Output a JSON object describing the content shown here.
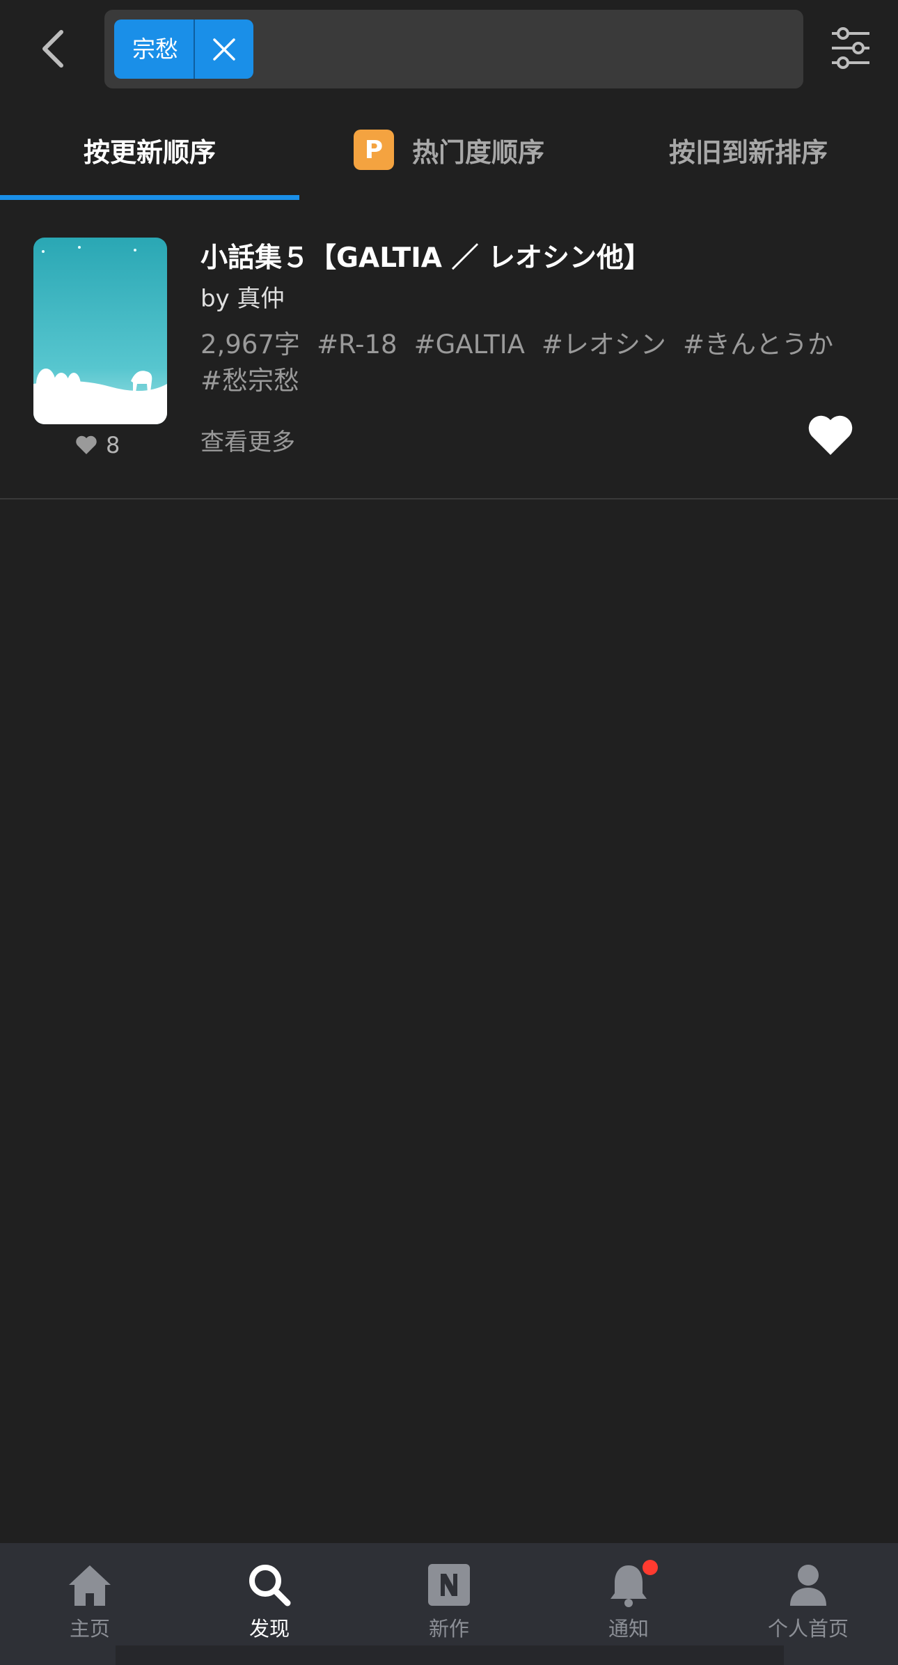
{
  "search": {
    "chip_label": "宗愁"
  },
  "tabs": [
    {
      "label": "按更新顺序",
      "active": true
    },
    {
      "label": "热门度顺序",
      "badge": "P",
      "active": false
    },
    {
      "label": "按旧到新排序",
      "active": false
    }
  ],
  "item": {
    "title": "小話集５【GALTIA ／ レオシン他】",
    "author": "by 真仲",
    "char_count": "2,967字",
    "tags": [
      "#R-18",
      "#GALTIA",
      "#レオシン",
      "#きんとうか",
      "#愁宗愁"
    ],
    "likes": "8",
    "more_label": "查看更多"
  },
  "bottom_nav": [
    {
      "label": "主页",
      "icon": "home-icon",
      "active": false
    },
    {
      "label": "发现",
      "icon": "search-icon",
      "active": true
    },
    {
      "label": "新作",
      "icon": "new-icon",
      "active": false
    },
    {
      "label": "通知",
      "icon": "bell-icon",
      "active": false,
      "has_badge": true
    },
    {
      "label": "个人首页",
      "icon": "profile-icon",
      "active": false
    }
  ],
  "colors": {
    "accent": "#1a8fe8",
    "badge": "#f4a340",
    "notification": "#ff3b30"
  }
}
